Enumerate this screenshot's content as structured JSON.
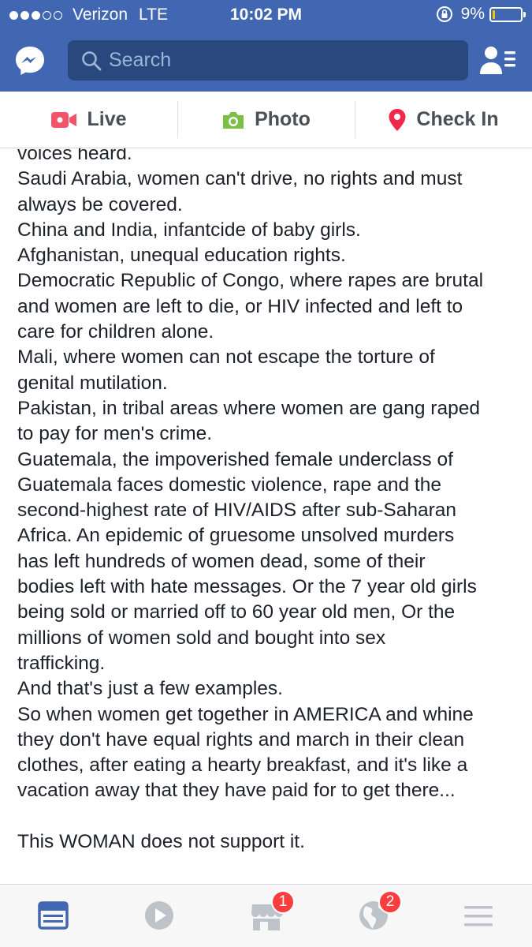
{
  "status_bar": {
    "carrier": "Verizon",
    "network": "LTE",
    "time": "10:02 PM",
    "battery_percent": "9%",
    "battery_level": 0.09,
    "signal_bars_filled": 3,
    "signal_bars_total": 5
  },
  "header": {
    "search_placeholder": "Search"
  },
  "composer": {
    "live_label": "Live",
    "photo_label": "Photo",
    "checkin_label": "Check In"
  },
  "post": {
    "lines": [
      "voices heard.",
      "Saudi Arabia, women can't drive, no rights and must",
      "always be covered.",
      "China and India, infantcide of baby girls.",
      "Afghanistan, unequal education rights.",
      "Democratic Republic of Congo, where rapes are brutal",
      "and women are left to die, or HIV infected and left to",
      "care for children alone.",
      "Mali, where women can not escape the torture of",
      "genital mutilation.",
      "Pakistan, in tribal areas where women are gang raped",
      "to pay for men's crime.",
      "Guatemala, the impoverished female underclass of",
      "Guatemala faces domestic violence, rape and the",
      "second-highest rate of HIV/AIDS after sub-Saharan",
      "Africa. An epidemic of gruesome unsolved murders",
      "has left hundreds of women dead, some of their",
      "bodies left with hate messages. Or the 7 year old girls",
      "being sold or married off to 60 year old men, Or the",
      "millions of women sold and bought into sex",
      "trafficking.",
      "And that's just a few examples.",
      "So when women get together in AMERICA and whine",
      "they don't have equal rights and march in their clean",
      "clothes, after eating a hearty breakfast, and it's like a",
      "vacation away that they have paid for to get there...",
      "",
      "This WOMAN does not support it."
    ]
  },
  "tabbar": {
    "marketplace_badge": "1",
    "notifications_badge": "2"
  },
  "colors": {
    "brand_blue": "#4267b2",
    "search_bg": "#29487d",
    "live_red": "#f35369",
    "photo_green": "#7bc043",
    "checkin_pink": "#f02849",
    "badge_red": "#fa3e3e",
    "active_tab": "#4267b2",
    "inactive_tab": "#bec2c9"
  }
}
